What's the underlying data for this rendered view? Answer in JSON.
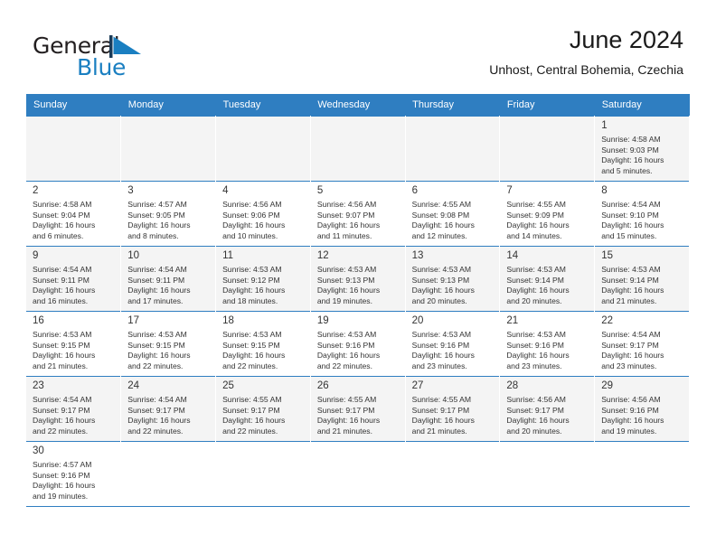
{
  "brand": {
    "name_top": "General",
    "name_bottom": "Blue",
    "flag_icon": "blue-flag-triangle-icon",
    "color_top": "#231f20",
    "color_bottom": "#1a7fc1"
  },
  "header": {
    "title": "June 2024",
    "subtitle": "Unhost, Central Bohemia, Czechia"
  },
  "theme": {
    "header_bg": "#2f7ec1",
    "header_text": "#ffffff",
    "row_shaded_bg": "#f4f4f4",
    "row_plain_bg": "#ffffff",
    "grid_line": "#2f7ec1",
    "text": "#333333"
  },
  "columns": [
    "Sunday",
    "Monday",
    "Tuesday",
    "Wednesday",
    "Thursday",
    "Friday",
    "Saturday"
  ],
  "weeks": [
    [
      {
        "day": "",
        "lines": []
      },
      {
        "day": "",
        "lines": []
      },
      {
        "day": "",
        "lines": []
      },
      {
        "day": "",
        "lines": []
      },
      {
        "day": "",
        "lines": []
      },
      {
        "day": "",
        "lines": []
      },
      {
        "day": "1",
        "lines": [
          "Sunrise: 4:58 AM",
          "Sunset: 9:03 PM",
          "Daylight: 16 hours",
          "and 5 minutes."
        ]
      }
    ],
    [
      {
        "day": "2",
        "lines": [
          "Sunrise: 4:58 AM",
          "Sunset: 9:04 PM",
          "Daylight: 16 hours",
          "and 6 minutes."
        ]
      },
      {
        "day": "3",
        "lines": [
          "Sunrise: 4:57 AM",
          "Sunset: 9:05 PM",
          "Daylight: 16 hours",
          "and 8 minutes."
        ]
      },
      {
        "day": "4",
        "lines": [
          "Sunrise: 4:56 AM",
          "Sunset: 9:06 PM",
          "Daylight: 16 hours",
          "and 10 minutes."
        ]
      },
      {
        "day": "5",
        "lines": [
          "Sunrise: 4:56 AM",
          "Sunset: 9:07 PM",
          "Daylight: 16 hours",
          "and 11 minutes."
        ]
      },
      {
        "day": "6",
        "lines": [
          "Sunrise: 4:55 AM",
          "Sunset: 9:08 PM",
          "Daylight: 16 hours",
          "and 12 minutes."
        ]
      },
      {
        "day": "7",
        "lines": [
          "Sunrise: 4:55 AM",
          "Sunset: 9:09 PM",
          "Daylight: 16 hours",
          "and 14 minutes."
        ]
      },
      {
        "day": "8",
        "lines": [
          "Sunrise: 4:54 AM",
          "Sunset: 9:10 PM",
          "Daylight: 16 hours",
          "and 15 minutes."
        ]
      }
    ],
    [
      {
        "day": "9",
        "lines": [
          "Sunrise: 4:54 AM",
          "Sunset: 9:11 PM",
          "Daylight: 16 hours",
          "and 16 minutes."
        ]
      },
      {
        "day": "10",
        "lines": [
          "Sunrise: 4:54 AM",
          "Sunset: 9:11 PM",
          "Daylight: 16 hours",
          "and 17 minutes."
        ]
      },
      {
        "day": "11",
        "lines": [
          "Sunrise: 4:53 AM",
          "Sunset: 9:12 PM",
          "Daylight: 16 hours",
          "and 18 minutes."
        ]
      },
      {
        "day": "12",
        "lines": [
          "Sunrise: 4:53 AM",
          "Sunset: 9:13 PM",
          "Daylight: 16 hours",
          "and 19 minutes."
        ]
      },
      {
        "day": "13",
        "lines": [
          "Sunrise: 4:53 AM",
          "Sunset: 9:13 PM",
          "Daylight: 16 hours",
          "and 20 minutes."
        ]
      },
      {
        "day": "14",
        "lines": [
          "Sunrise: 4:53 AM",
          "Sunset: 9:14 PM",
          "Daylight: 16 hours",
          "and 20 minutes."
        ]
      },
      {
        "day": "15",
        "lines": [
          "Sunrise: 4:53 AM",
          "Sunset: 9:14 PM",
          "Daylight: 16 hours",
          "and 21 minutes."
        ]
      }
    ],
    [
      {
        "day": "16",
        "lines": [
          "Sunrise: 4:53 AM",
          "Sunset: 9:15 PM",
          "Daylight: 16 hours",
          "and 21 minutes."
        ]
      },
      {
        "day": "17",
        "lines": [
          "Sunrise: 4:53 AM",
          "Sunset: 9:15 PM",
          "Daylight: 16 hours",
          "and 22 minutes."
        ]
      },
      {
        "day": "18",
        "lines": [
          "Sunrise: 4:53 AM",
          "Sunset: 9:15 PM",
          "Daylight: 16 hours",
          "and 22 minutes."
        ]
      },
      {
        "day": "19",
        "lines": [
          "Sunrise: 4:53 AM",
          "Sunset: 9:16 PM",
          "Daylight: 16 hours",
          "and 22 minutes."
        ]
      },
      {
        "day": "20",
        "lines": [
          "Sunrise: 4:53 AM",
          "Sunset: 9:16 PM",
          "Daylight: 16 hours",
          "and 23 minutes."
        ]
      },
      {
        "day": "21",
        "lines": [
          "Sunrise: 4:53 AM",
          "Sunset: 9:16 PM",
          "Daylight: 16 hours",
          "and 23 minutes."
        ]
      },
      {
        "day": "22",
        "lines": [
          "Sunrise: 4:54 AM",
          "Sunset: 9:17 PM",
          "Daylight: 16 hours",
          "and 23 minutes."
        ]
      }
    ],
    [
      {
        "day": "23",
        "lines": [
          "Sunrise: 4:54 AM",
          "Sunset: 9:17 PM",
          "Daylight: 16 hours",
          "and 22 minutes."
        ]
      },
      {
        "day": "24",
        "lines": [
          "Sunrise: 4:54 AM",
          "Sunset: 9:17 PM",
          "Daylight: 16 hours",
          "and 22 minutes."
        ]
      },
      {
        "day": "25",
        "lines": [
          "Sunrise: 4:55 AM",
          "Sunset: 9:17 PM",
          "Daylight: 16 hours",
          "and 22 minutes."
        ]
      },
      {
        "day": "26",
        "lines": [
          "Sunrise: 4:55 AM",
          "Sunset: 9:17 PM",
          "Daylight: 16 hours",
          "and 21 minutes."
        ]
      },
      {
        "day": "27",
        "lines": [
          "Sunrise: 4:55 AM",
          "Sunset: 9:17 PM",
          "Daylight: 16 hours",
          "and 21 minutes."
        ]
      },
      {
        "day": "28",
        "lines": [
          "Sunrise: 4:56 AM",
          "Sunset: 9:17 PM",
          "Daylight: 16 hours",
          "and 20 minutes."
        ]
      },
      {
        "day": "29",
        "lines": [
          "Sunrise: 4:56 AM",
          "Sunset: 9:16 PM",
          "Daylight: 16 hours",
          "and 19 minutes."
        ]
      }
    ],
    [
      {
        "day": "30",
        "lines": [
          "Sunrise: 4:57 AM",
          "Sunset: 9:16 PM",
          "Daylight: 16 hours",
          "and 19 minutes."
        ]
      },
      {
        "day": "",
        "lines": []
      },
      {
        "day": "",
        "lines": []
      },
      {
        "day": "",
        "lines": []
      },
      {
        "day": "",
        "lines": []
      },
      {
        "day": "",
        "lines": []
      },
      {
        "day": "",
        "lines": []
      }
    ]
  ]
}
